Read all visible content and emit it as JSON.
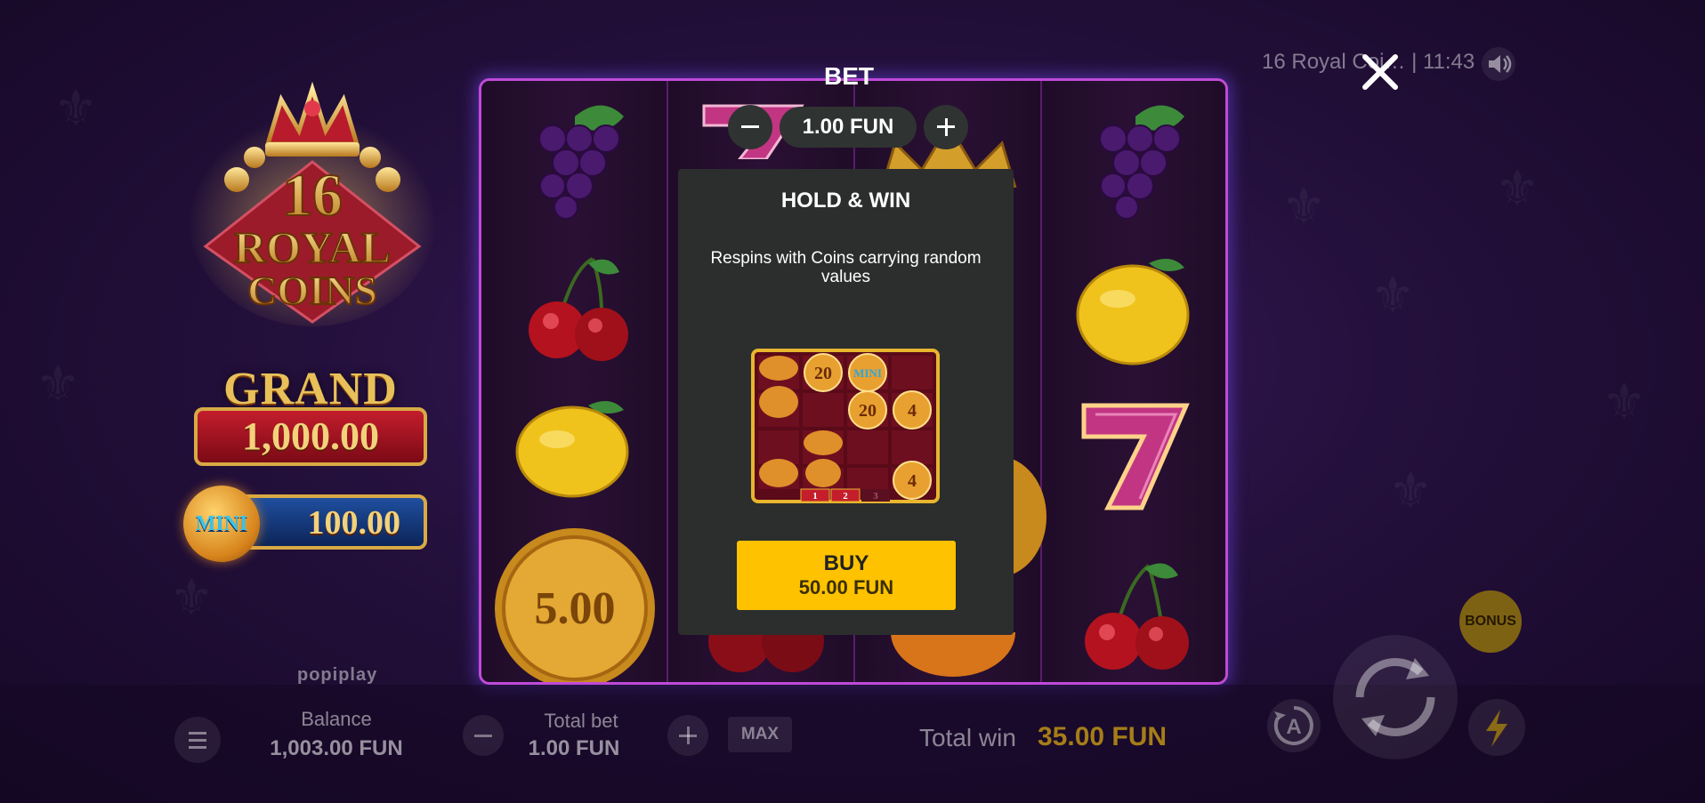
{
  "header": {
    "game_title": "16 Royal Coins",
    "time": "11:43",
    "info_text": "16 Royal Coi… | 11:43",
    "sound_icon": "speaker-icon",
    "close_icon": "close-icon"
  },
  "logo": {
    "line1": "16",
    "line2": "ROYAL",
    "line3": "COINS"
  },
  "jackpots": {
    "grand_label": "GRAND",
    "grand_value": "1,000.00",
    "mini_label": "MINI",
    "mini_value": "100.00"
  },
  "bet": {
    "title": "BET",
    "value": "1.00 FUN"
  },
  "modal": {
    "title": "HOLD & WIN",
    "description": "Respins with Coins carrying random values",
    "preview": {
      "coin_values": [
        "20",
        "MINI",
        "20",
        "4",
        "4"
      ],
      "respin_counter": [
        "1",
        "2",
        "3"
      ]
    },
    "buy_label": "BUY",
    "buy_price": "50.00 FUN"
  },
  "reels": {
    "coin_value": "5.00",
    "symbols": [
      "grapes",
      "cherries",
      "lemon",
      "coin",
      "seven",
      "crown",
      "grapes",
      "lemon",
      "seven",
      "cherries"
    ]
  },
  "brand": "popiplay",
  "bottom_bar": {
    "balance_label": "Balance",
    "balance_value": "1,003.00 FUN",
    "total_bet_label": "Total bet",
    "total_bet_value": "1.00 FUN",
    "max_label": "MAX",
    "total_win_label": "Total win",
    "total_win_value": "35.00 FUN",
    "bonus_label": "BONUS",
    "auto_letter": "A"
  },
  "colors": {
    "accent_yellow": "#ffc200",
    "modal_bg": "#2b2e2d",
    "reel_border": "#c04ad8",
    "win_gold": "#a57d18"
  }
}
